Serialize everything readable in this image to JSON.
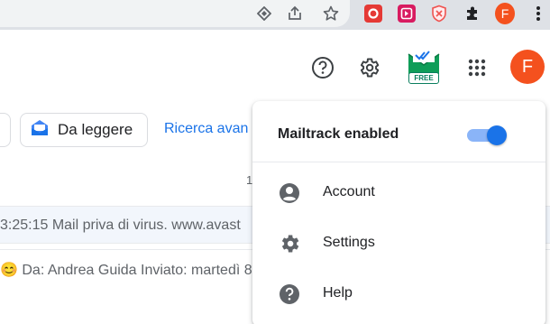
{
  "browser": {
    "extensions": [
      {
        "name": "opera-ext",
        "color": "#e53935"
      },
      {
        "name": "media-ext",
        "color": "#d81b60"
      },
      {
        "name": "shield-ext",
        "color": "#ef5350"
      }
    ],
    "profile_initial": "F",
    "accent": "#f4511e"
  },
  "gmail": {
    "avatar_initial": "F",
    "mailtrack_badge": "FREE",
    "chips": {
      "read_later": "Da leggere"
    },
    "advanced_search_link": "Ricerca avan",
    "page_indicator": "1",
    "rows": [
      {
        "text": "3:25:15 Mail priva di virus. www.avast"
      },
      {
        "text": "😊 Da: Andrea Guida Inviato: martedì 8"
      }
    ]
  },
  "menu": {
    "mailtrack_label": "Mailtrack enabled",
    "mailtrack_enabled": true,
    "items": [
      {
        "label": "Account",
        "icon": "account-circle-icon"
      },
      {
        "label": "Settings",
        "icon": "gear-icon"
      },
      {
        "label": "Help",
        "icon": "help-icon"
      }
    ]
  },
  "colors": {
    "link": "#1a73e8",
    "toggle_on": "#1a73e8",
    "toggle_track": "#8ab4f8"
  }
}
